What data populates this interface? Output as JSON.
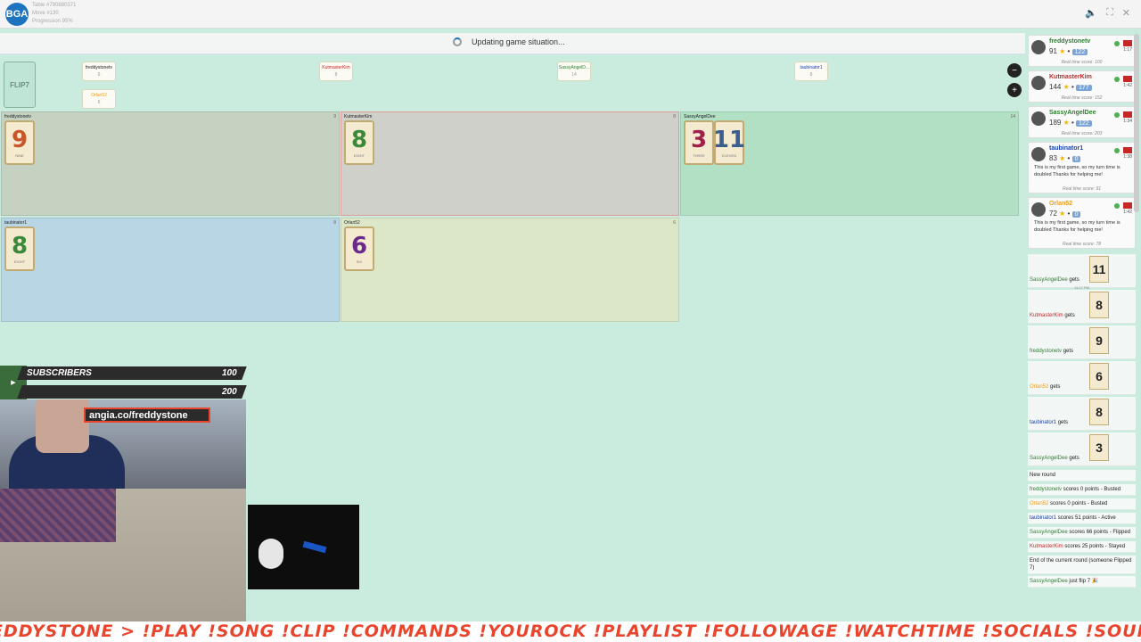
{
  "header": {
    "logo": "BGA",
    "table": "Table #790880371",
    "move": "Move #130",
    "progression": "Progression 95%",
    "icons": [
      "speaker-icon",
      "fullscreen-icon",
      "close-icon"
    ]
  },
  "status": {
    "text": "Updating game situation..."
  },
  "deck": {
    "label": "FLIP7"
  },
  "player_tags": [
    {
      "name": "freddystonetv",
      "count": "9"
    },
    {
      "name": "Orlan52",
      "count": "6"
    },
    {
      "name": "KutmasterKim",
      "count": "8"
    },
    {
      "name": "SassyAngelD...",
      "count": "14"
    },
    {
      "name": "taubinator1",
      "count": "8"
    }
  ],
  "zones": [
    {
      "name": "freddystonetv",
      "score": "9",
      "color": "#c5d2c2",
      "cards": [
        {
          "num": "9",
          "word": "NINE",
          "col": "#c9552b"
        }
      ]
    },
    {
      "name": "KutmasterKim",
      "score": "8",
      "color": "#d0d0cb",
      "cards": [
        {
          "num": "8",
          "word": "EIGHT",
          "col": "#3a8a3a"
        }
      ]
    },
    {
      "name": "SassyAngelDee",
      "score": "14",
      "color": "#b2e0c5",
      "cards": [
        {
          "num": "3",
          "word": "THREE",
          "col": "#a01f4b"
        },
        {
          "num": "11",
          "word": "ELEVEN",
          "col": "#3a5e8e"
        }
      ]
    },
    {
      "name": "taubinator1",
      "score": "8",
      "color": "#b8d6e4",
      "cards": [
        {
          "num": "8",
          "word": "EIGHT",
          "col": "#3a8a3a"
        }
      ]
    },
    {
      "name": "Orlan52",
      "score": "6",
      "color": "#dce7c8",
      "cards": [
        {
          "num": "6",
          "word": "SIX",
          "col": "#6a2a8a"
        }
      ]
    }
  ],
  "overlay": {
    "subscribers_label": "SUBSCRIBERS",
    "subscribers_value": "100",
    "second_value": "200",
    "url": "angia.co/freddystone"
  },
  "ticker": "EDDYSTONE >  !PLAY !SONG !CLIP !COMMANDS  !YOUROCK  !PLAYLIST  !FOLLOWAGE  !WATCHTIME  !SOCIALS  !SOUNDCLOUD  !DISCORD  !GAME",
  "players": [
    {
      "name": "freddystonetv",
      "color": "#2e7d32",
      "score": "91",
      "chip": "122",
      "time": "1:17",
      "rts": "Real time score: 100",
      "msg": ""
    },
    {
      "name": "KutmasterKim",
      "color": "#c62828",
      "score": "144",
      "chip": "177",
      "time": "1:42",
      "rts": "Real time score: 152",
      "msg": ""
    },
    {
      "name": "SassyAngelDee",
      "color": "#2e7d32",
      "score": "189",
      "chip": "122",
      "time": "1:34",
      "rts": "Real time score: 203",
      "msg": ""
    },
    {
      "name": "taubinator1",
      "color": "#1a3fa8",
      "score": "83",
      "chip": "0",
      "time": "1:38",
      "rts": "Real time score: 91",
      "msg": "This is my first game, so my turn time is doubled Thanks for helping me!"
    },
    {
      "name": "Orlan52",
      "color": "#f39c12",
      "score": "72",
      "chip": "0",
      "time": "1:42",
      "rts": "Real time score: 78",
      "msg": "This is my first game, so my turn time is doubled Thanks for helping me!"
    }
  ],
  "log": [
    {
      "player": "SassyAngelDee",
      "color": "#2e7d32",
      "verb": "gets",
      "card": "11",
      "time": "11:17 PM"
    },
    {
      "player": "KutmasterKim",
      "color": "#c62828",
      "verb": "gets",
      "card": "8",
      "time": ""
    },
    {
      "player": "freddystonetv",
      "color": "#2e7d32",
      "verb": "gets",
      "card": "9",
      "time": ""
    },
    {
      "player": "Orlan52",
      "color": "#f39c12",
      "verb": "gets",
      "card": "6",
      "time": ""
    },
    {
      "player": "taubinator1",
      "color": "#1a3fa8",
      "verb": "gets",
      "card": "8",
      "time": ""
    },
    {
      "player": "SassyAngelDee",
      "color": "#2e7d32",
      "verb": "gets",
      "card": "3",
      "time": ""
    }
  ],
  "textlog": [
    {
      "text": "New round",
      "player": "",
      "color": "#333"
    },
    {
      "player": "freddystonetv",
      "color": "#2e7d32",
      "text": " scores 0 points - Busted"
    },
    {
      "player": "Orlan52",
      "color": "#f39c12",
      "text": " scores 0 points - Busted"
    },
    {
      "player": "taubinator1",
      "color": "#1a3fa8",
      "text": " scores 51 points - Active"
    },
    {
      "player": "SassyAngelDee",
      "color": "#2e7d32",
      "text": " scores 66 points - Flipped"
    },
    {
      "player": "KutmasterKim",
      "color": "#c62828",
      "text": " scores 25 points - Stayed"
    },
    {
      "player": "",
      "color": "#333",
      "text": "End of the current round (someone Flipped 7)"
    },
    {
      "player": "SassyAngelDee",
      "color": "#2e7d32",
      "text": " just flip 7 🎉"
    }
  ]
}
